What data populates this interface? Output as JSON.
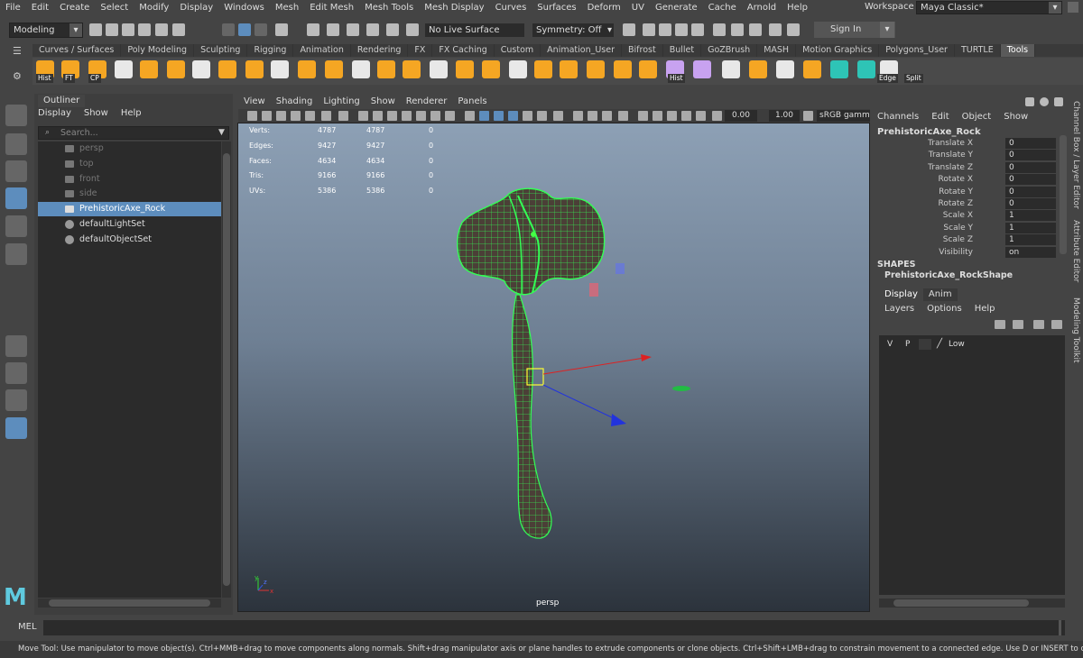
{
  "menubar": {
    "items": [
      "File",
      "Edit",
      "Create",
      "Select",
      "Modify",
      "Display",
      "Windows",
      "Mesh",
      "Edit Mesh",
      "Mesh Tools",
      "Mesh Display",
      "Curves",
      "Surfaces",
      "Deform",
      "UV",
      "Generate",
      "Cache",
      "Arnold",
      "Help"
    ],
    "workspace_label": "Workspace :",
    "workspace_value": "Maya Classic*"
  },
  "statusline": {
    "mode": "Modeling",
    "live_surface": "No Live Surface",
    "symmetry": "Symmetry: Off",
    "sign_in": "Sign In"
  },
  "shelf": {
    "tabs": [
      "Curves / Surfaces",
      "Poly Modeling",
      "Sculpting",
      "Rigging",
      "Animation",
      "Rendering",
      "FX",
      "FX Caching",
      "Custom",
      "Animation_User",
      "Bifrost",
      "Bullet",
      "GoZBrush",
      "MASH",
      "Motion Graphics",
      "Polygons_User",
      "TURTLE",
      "Tools"
    ],
    "active_tab": "Tools",
    "labels": {
      "hist1": "Hist",
      "ft": "FT",
      "cp": "CP",
      "hist2": "Hist",
      "edge": "Edge",
      "split": "Split"
    }
  },
  "outliner": {
    "title": "Outliner",
    "menu": [
      "Display",
      "Show",
      "Help"
    ],
    "search_placeholder": "Search...",
    "items": [
      {
        "label": "persp",
        "kind": "camera",
        "dim": true
      },
      {
        "label": "top",
        "kind": "camera",
        "dim": true
      },
      {
        "label": "front",
        "kind": "camera",
        "dim": true
      },
      {
        "label": "side",
        "kind": "camera",
        "dim": true
      },
      {
        "label": "PrehistoricAxe_Rock",
        "kind": "mesh",
        "selected": true
      },
      {
        "label": "defaultLightSet",
        "kind": "set"
      },
      {
        "label": "defaultObjectSet",
        "kind": "set"
      }
    ]
  },
  "viewport": {
    "menu": [
      "View",
      "Shading",
      "Lighting",
      "Show",
      "Renderer",
      "Panels"
    ],
    "field1": "0.00",
    "field2": "1.00",
    "colorspace": "sRGB gamma",
    "camera_label": "persp",
    "hud": [
      {
        "label": "Verts:",
        "a": "4787",
        "b": "4787",
        "c": "0"
      },
      {
        "label": "Edges:",
        "a": "9427",
        "b": "9427",
        "c": "0"
      },
      {
        "label": "Faces:",
        "a": "4634",
        "b": "4634",
        "c": "0"
      },
      {
        "label": "Tris:",
        "a": "9166",
        "b": "9166",
        "c": "0"
      },
      {
        "label": "UVs:",
        "a": "5386",
        "b": "5386",
        "c": "0"
      }
    ],
    "axis_labels": {
      "x": "x",
      "y": "y",
      "z": "z"
    }
  },
  "channelbox": {
    "menu": [
      "Channels",
      "Edit",
      "Object",
      "Show"
    ],
    "object_name": "PrehistoricAxe_Rock",
    "channels": [
      {
        "label": "Translate X",
        "value": "0"
      },
      {
        "label": "Translate Y",
        "value": "0"
      },
      {
        "label": "Translate Z",
        "value": "0"
      },
      {
        "label": "Rotate X",
        "value": "0"
      },
      {
        "label": "Rotate Y",
        "value": "0"
      },
      {
        "label": "Rotate Z",
        "value": "0"
      },
      {
        "label": "Scale X",
        "value": "1"
      },
      {
        "label": "Scale Y",
        "value": "1"
      },
      {
        "label": "Scale Z",
        "value": "1"
      },
      {
        "label": "Visibility",
        "value": "on"
      }
    ],
    "shapes_heading": "SHAPES",
    "shape_name": "PrehistoricAxe_RockShape"
  },
  "layers": {
    "tabs": [
      "Display",
      "Anim"
    ],
    "menu": [
      "Layers",
      "Options",
      "Help"
    ],
    "row": {
      "v": "V",
      "p": "P",
      "name": "Low"
    }
  },
  "side_tabs": [
    "Channel Box / Layer Editor",
    "Attribute Editor",
    "Modeling Toolkit"
  ],
  "cmdline": {
    "label": "MEL"
  },
  "helpline": "Move Tool: Use manipulator to move object(s). Ctrl+MMB+drag to move components along normals. Shift+drag manipulator axis or plane handles to extrude components or clone objects. Ctrl+Shift+LMB+drag to constrain movement to a connected edge. Use D or INSERT to change the pivot position and axis orientatio",
  "colors": {
    "selection": "#5d8dbd",
    "wireframe": "#33ff55",
    "maya_logo": "#5fcadf"
  }
}
